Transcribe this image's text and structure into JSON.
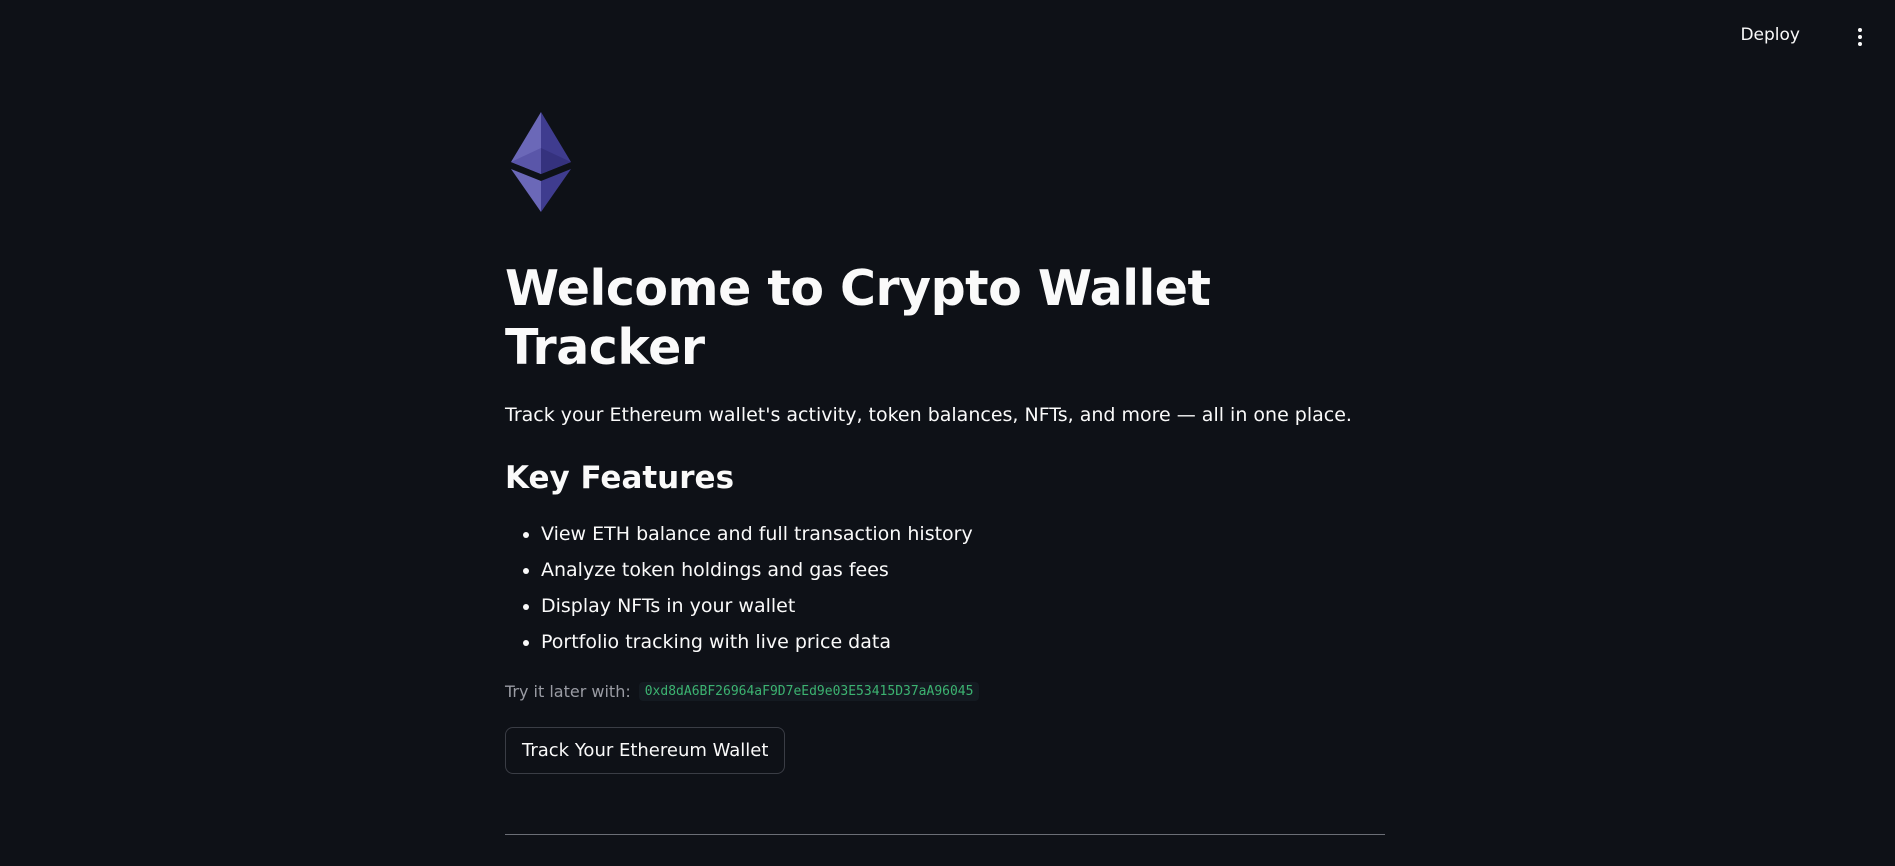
{
  "header": {
    "deploy_label": "Deploy",
    "menu_icon": "vertical-ellipsis-icon"
  },
  "logo": {
    "icon": "ethereum-logo-icon",
    "colors": {
      "light": "#6b68b8",
      "dark": "#3f3c8f",
      "mid": "#5752a6"
    }
  },
  "main": {
    "title": "Welcome to Crypto Wallet Tracker",
    "subtitle": "Track your Ethereum wallet's activity, token balances, NFTs, and more — all in one place.",
    "features_heading": "Key Features",
    "features": [
      "View ETH balance and full transaction history",
      "Analyze token holdings and gas fees",
      "Display NFTs in your wallet",
      "Portfolio tracking with live price data"
    ],
    "try_label": "Try it later with:",
    "example_address": "0xd8dA6BF26964aF9D7eEd9e03E53415D37aA96045",
    "track_button_label": "Track Your Ethereum Wallet"
  },
  "colors": {
    "background": "#0e1117",
    "text": "#fafafa",
    "code_green": "#3cb371",
    "muted": "#9a9ca4"
  }
}
